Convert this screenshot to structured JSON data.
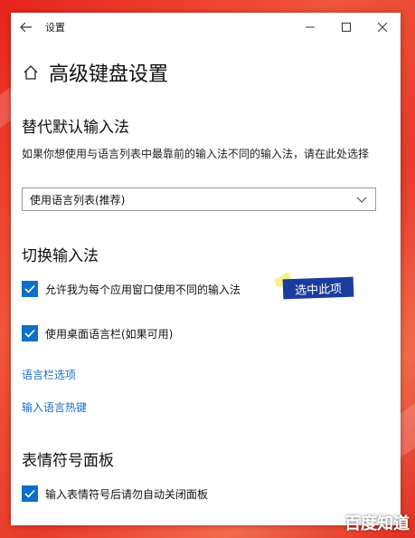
{
  "window": {
    "title": "设置",
    "page_title": "高级键盘设置"
  },
  "override": {
    "heading": "替代默认输入法",
    "description": "如果你想使用与语言列表中最靠前的输入法不同的输入法，请在此处选择",
    "select_value": "使用语言列表(推荐)"
  },
  "switch": {
    "heading": "切换输入法",
    "checkbox1_label": "允许我为每个应用窗口使用不同的输入法",
    "checkbox2_label": "使用桌面语言栏(如果可用)",
    "link1": "语言栏选项",
    "link2": "输入语言热键"
  },
  "annotation": {
    "callout": "选中此项"
  },
  "emoji": {
    "heading": "表情符号面板",
    "checkbox_label": "输入表情符号后请勿自动关闭面板"
  },
  "watermark": "百度知道",
  "colors": {
    "accent": "#0e6fc9",
    "link": "#1a6ec8",
    "callout_bg": "#1a3c9c"
  }
}
